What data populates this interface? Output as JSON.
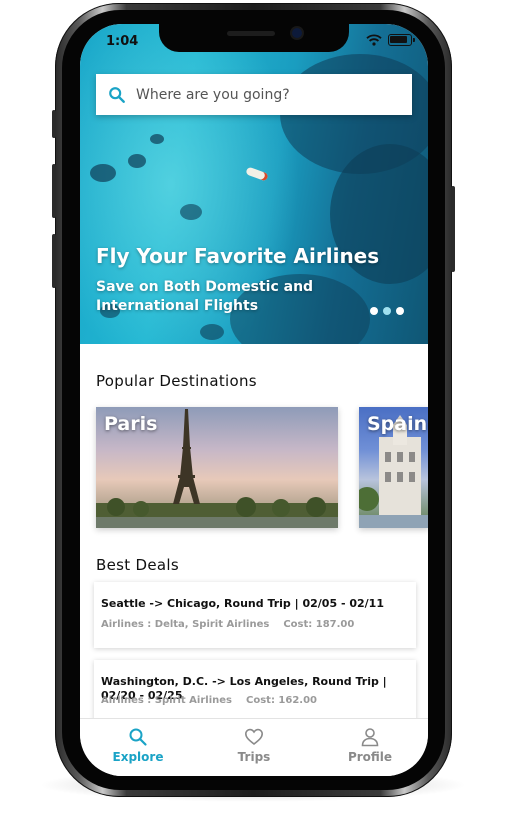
{
  "status_bar": {
    "time": "1:04"
  },
  "search": {
    "placeholder": "Where are you going?"
  },
  "hero": {
    "title": "Fly Your Favorite Airlines",
    "subtitle": "Save on Both Domestic and International Flights",
    "carousel_active_index": 1,
    "carousel_count": 3
  },
  "popular": {
    "title": "Popular Destinations",
    "items": [
      {
        "label": "Paris"
      },
      {
        "label": "Spain"
      }
    ]
  },
  "deals": {
    "title": "Best Deals",
    "items": [
      {
        "route": "Seattle -> Chicago, Round Trip | 02/05 - 02/11",
        "airlines": "Airlines : Delta, Spirit Airlines",
        "cost": "Cost: 187.00"
      },
      {
        "route": "Washington, D.C. -> Los Angeles, Round Trip | 02/20 - 02/25",
        "airlines": "Airlines : Spirit Airlines",
        "cost": "Cost: 162.00"
      }
    ]
  },
  "tabs": [
    {
      "label": "Explore",
      "icon": "search-icon",
      "active": true
    },
    {
      "label": "Trips",
      "icon": "heart-icon",
      "active": false
    },
    {
      "label": "Profile",
      "icon": "user-icon",
      "active": false
    }
  ],
  "colors": {
    "accent": "#1aa3c6",
    "inactive_tab": "#8a8a8a",
    "meta_text": "#9a9a9a"
  }
}
